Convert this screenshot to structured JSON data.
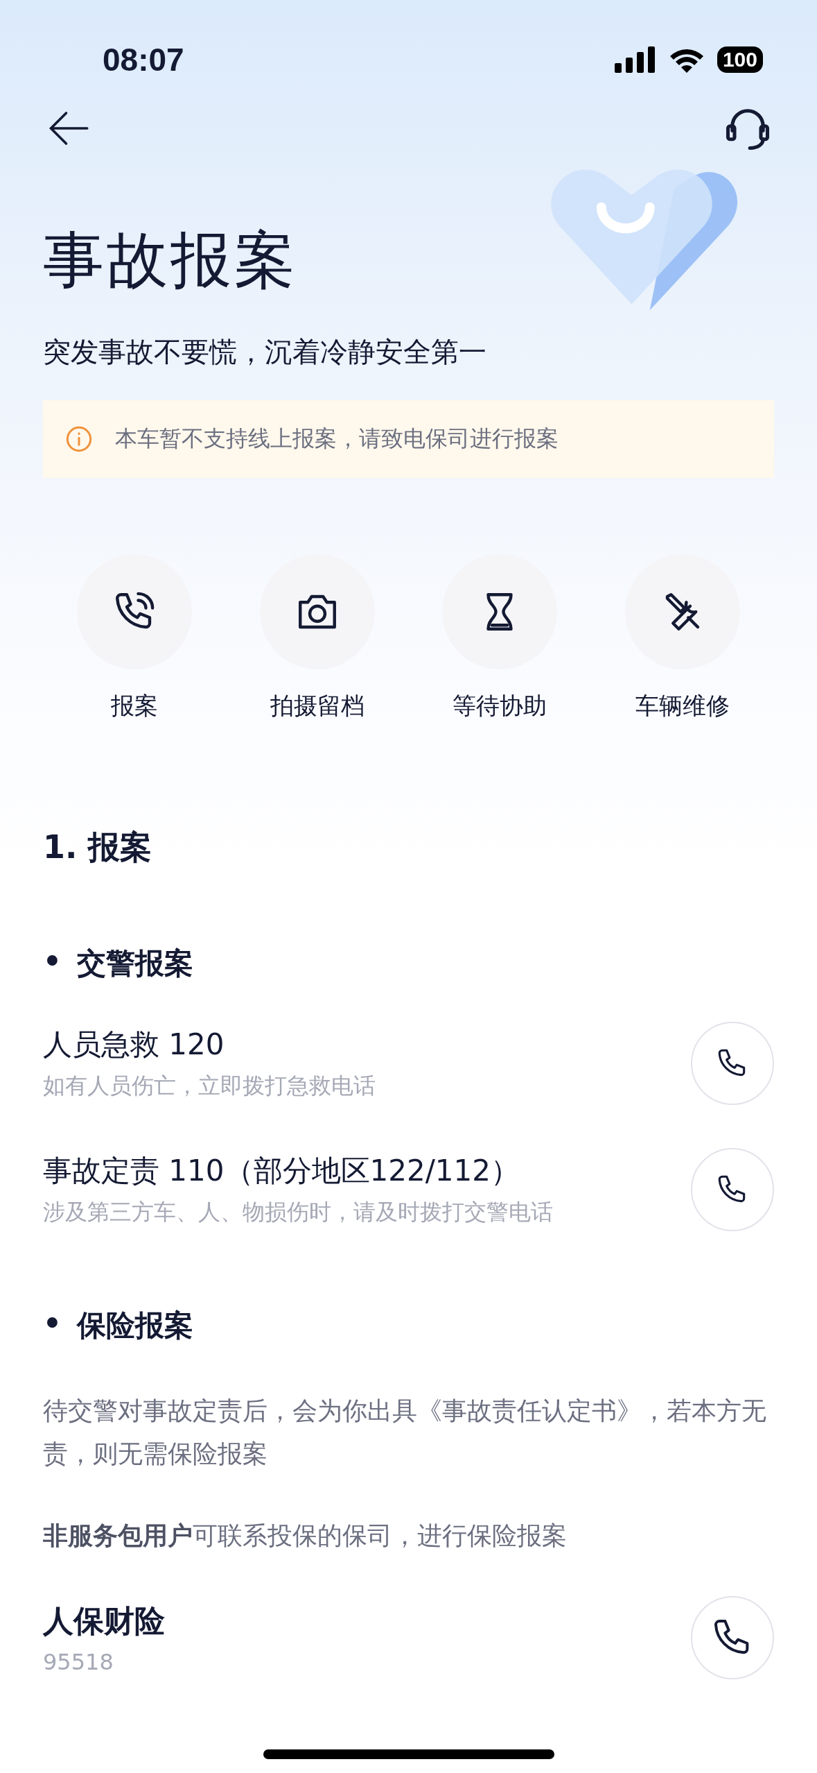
{
  "status_bar": {
    "time": "08:07",
    "battery": "100"
  },
  "title": "事故报案",
  "subtitle": "突发事故不要慌，沉着冷静安全第一",
  "notice": {
    "text": "本车暂不支持线上报案，请致电保司进行报案"
  },
  "steps": [
    {
      "kind": "phone",
      "label": "报案"
    },
    {
      "kind": "camera",
      "label": "拍摄留档"
    },
    {
      "kind": "hourglass",
      "label": "等待协助"
    },
    {
      "kind": "tools",
      "label": "车辆维修"
    }
  ],
  "section": {
    "heading": "1. 报案",
    "groups": [
      {
        "heading": "交警报案",
        "bullet": "•",
        "contacts": [
          {
            "title": "人员急救 120",
            "subtitle": "如有人员伤亡，立即拨打急救电话"
          },
          {
            "title": "事故定责 110（部分地区122/112）",
            "subtitle": "涉及第三方车、人、物损伤时，请及时拨打交警电话"
          }
        ]
      },
      {
        "heading": "保险报案",
        "bullet": "•",
        "paragraphs": [
          "待交警对事故定责后，会为你出具《事故责任认定书》，若本方无责，则无需保险报案",
          "**非服务包用户**可联系投保的保司，进行保险报案"
        ],
        "contacts": [
          {
            "title": "人保财险",
            "subtitle": "95518",
            "emphasis": true
          }
        ]
      }
    ]
  }
}
